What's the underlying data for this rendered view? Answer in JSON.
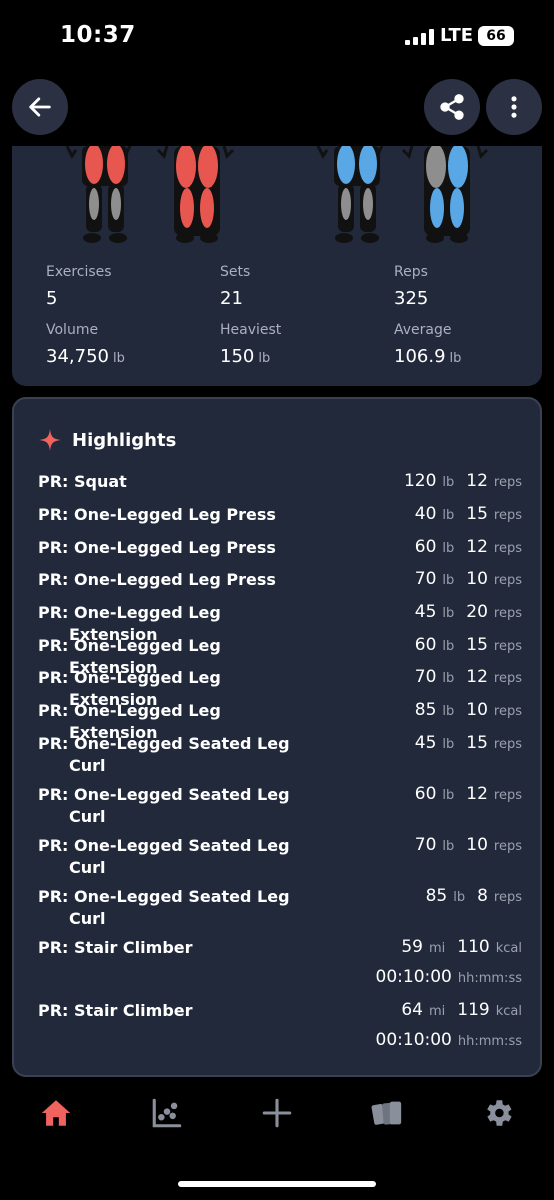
{
  "status_bar": {
    "time": "10:37",
    "network": "LTE",
    "battery": "66"
  },
  "summary": {
    "stats": [
      {
        "label": "Exercises",
        "value": "5",
        "unit": ""
      },
      {
        "label": "Sets",
        "value": "21",
        "unit": ""
      },
      {
        "label": "Reps",
        "value": "325",
        "unit": ""
      },
      {
        "label": "Volume",
        "value": "34,750",
        "unit": "lb"
      },
      {
        "label": "Heaviest",
        "value": "150",
        "unit": "lb"
      },
      {
        "label": "Average",
        "value": "106.9",
        "unit": "lb"
      }
    ]
  },
  "highlights": {
    "title": "Highlights",
    "rows": [
      {
        "name": "PR: Squat",
        "weight": "120",
        "weight_unit": "lb",
        "count": "12",
        "count_unit": "reps"
      },
      {
        "name": "PR: One-Legged Leg Press",
        "weight": "40",
        "weight_unit": "lb",
        "count": "15",
        "count_unit": "reps"
      },
      {
        "name": "PR: One-Legged Leg Press",
        "weight": "60",
        "weight_unit": "lb",
        "count": "12",
        "count_unit": "reps"
      },
      {
        "name": "PR: One-Legged Leg Press",
        "weight": "70",
        "weight_unit": "lb",
        "count": "10",
        "count_unit": "reps"
      },
      {
        "name": "PR: One-Legged Leg Extension",
        "weight": "45",
        "weight_unit": "lb",
        "count": "20",
        "count_unit": "reps"
      },
      {
        "name": "PR: One-Legged Leg Extension",
        "weight": "60",
        "weight_unit": "lb",
        "count": "15",
        "count_unit": "reps"
      },
      {
        "name": "PR: One-Legged Leg Extension",
        "weight": "70",
        "weight_unit": "lb",
        "count": "12",
        "count_unit": "reps"
      },
      {
        "name": "PR: One-Legged Leg Extension",
        "weight": "85",
        "weight_unit": "lb",
        "count": "10",
        "count_unit": "reps"
      },
      {
        "name": "PR: One-Legged Seated Leg Curl",
        "weight": "45",
        "weight_unit": "lb",
        "count": "15",
        "count_unit": "reps"
      },
      {
        "name": "PR: One-Legged Seated Leg Curl",
        "weight": "60",
        "weight_unit": "lb",
        "count": "12",
        "count_unit": "reps"
      },
      {
        "name": "PR: One-Legged Seated Leg Curl",
        "weight": "70",
        "weight_unit": "lb",
        "count": "10",
        "count_unit": "reps"
      },
      {
        "name": "PR: One-Legged Seated Leg Curl",
        "weight": "85",
        "weight_unit": "lb",
        "count": "8",
        "count_unit": "reps"
      },
      {
        "name": "PR: Stair Climber",
        "weight": "59",
        "weight_unit": "mi",
        "count": "110",
        "count_unit": "kcal",
        "time": "00:10:00",
        "time_unit": "hh:mm:ss"
      },
      {
        "name": "PR: Stair Climber",
        "weight": "64",
        "weight_unit": "mi",
        "count": "119",
        "count_unit": "kcal",
        "time": "00:10:00",
        "time_unit": "hh:mm:ss"
      }
    ]
  },
  "nav": {
    "items": [
      {
        "icon": "home-icon",
        "active": true
      },
      {
        "icon": "chart-icon",
        "active": false
      },
      {
        "icon": "plus-icon",
        "active": false
      },
      {
        "icon": "cards-icon",
        "active": false
      },
      {
        "icon": "gear-icon",
        "active": false
      }
    ]
  },
  "colors": {
    "accent": "#f0635f",
    "card": "#22293a",
    "muscle_red": "#e8574f",
    "muscle_blue": "#5aa7e6",
    "inactive_icon": "#8a8f9c"
  }
}
